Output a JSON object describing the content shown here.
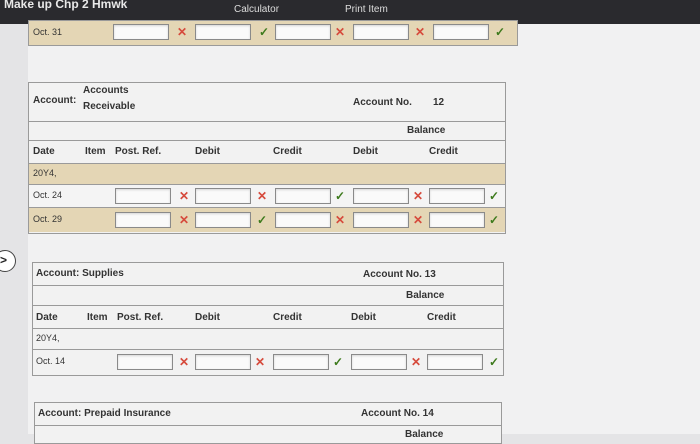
{
  "topbar": {
    "title": "Make up Chp 2 Hmwk",
    "calculator": "Calculator",
    "print": "Print Item"
  },
  "top_row": {
    "date": "Oct. 31"
  },
  "accounts_receivable": {
    "account_label": "Account:",
    "account_name_1": "Accounts",
    "account_name_2": "Receivable",
    "account_no_label": "Account No.",
    "account_no": "12",
    "balance": "Balance",
    "headers": {
      "date": "Date",
      "item": "Item",
      "post_ref": "Post. Ref.",
      "debit": "Debit",
      "credit": "Credit",
      "bal_debit": "Debit",
      "bal_credit": "Credit"
    },
    "year": "20Y4,",
    "rows": [
      {
        "date": "Oct. 24"
      },
      {
        "date": "Oct. 29"
      }
    ]
  },
  "supplies": {
    "account_title": "Account: Supplies",
    "account_no": "Account No. 13",
    "balance": "Balance",
    "headers": {
      "date": "Date",
      "item": "Item",
      "post_ref": "Post. Ref.",
      "debit": "Debit",
      "credit": "Credit",
      "bal_debit": "Debit",
      "bal_credit": "Credit"
    },
    "year": "20Y4,",
    "rows": [
      {
        "date": "Oct. 14"
      }
    ]
  },
  "prepaid_insurance": {
    "account_title": "Account: Prepaid Insurance",
    "account_no": "Account No. 14",
    "balance": "Balance"
  },
  "marks": {
    "wrong": "✕",
    "right": "✓"
  }
}
